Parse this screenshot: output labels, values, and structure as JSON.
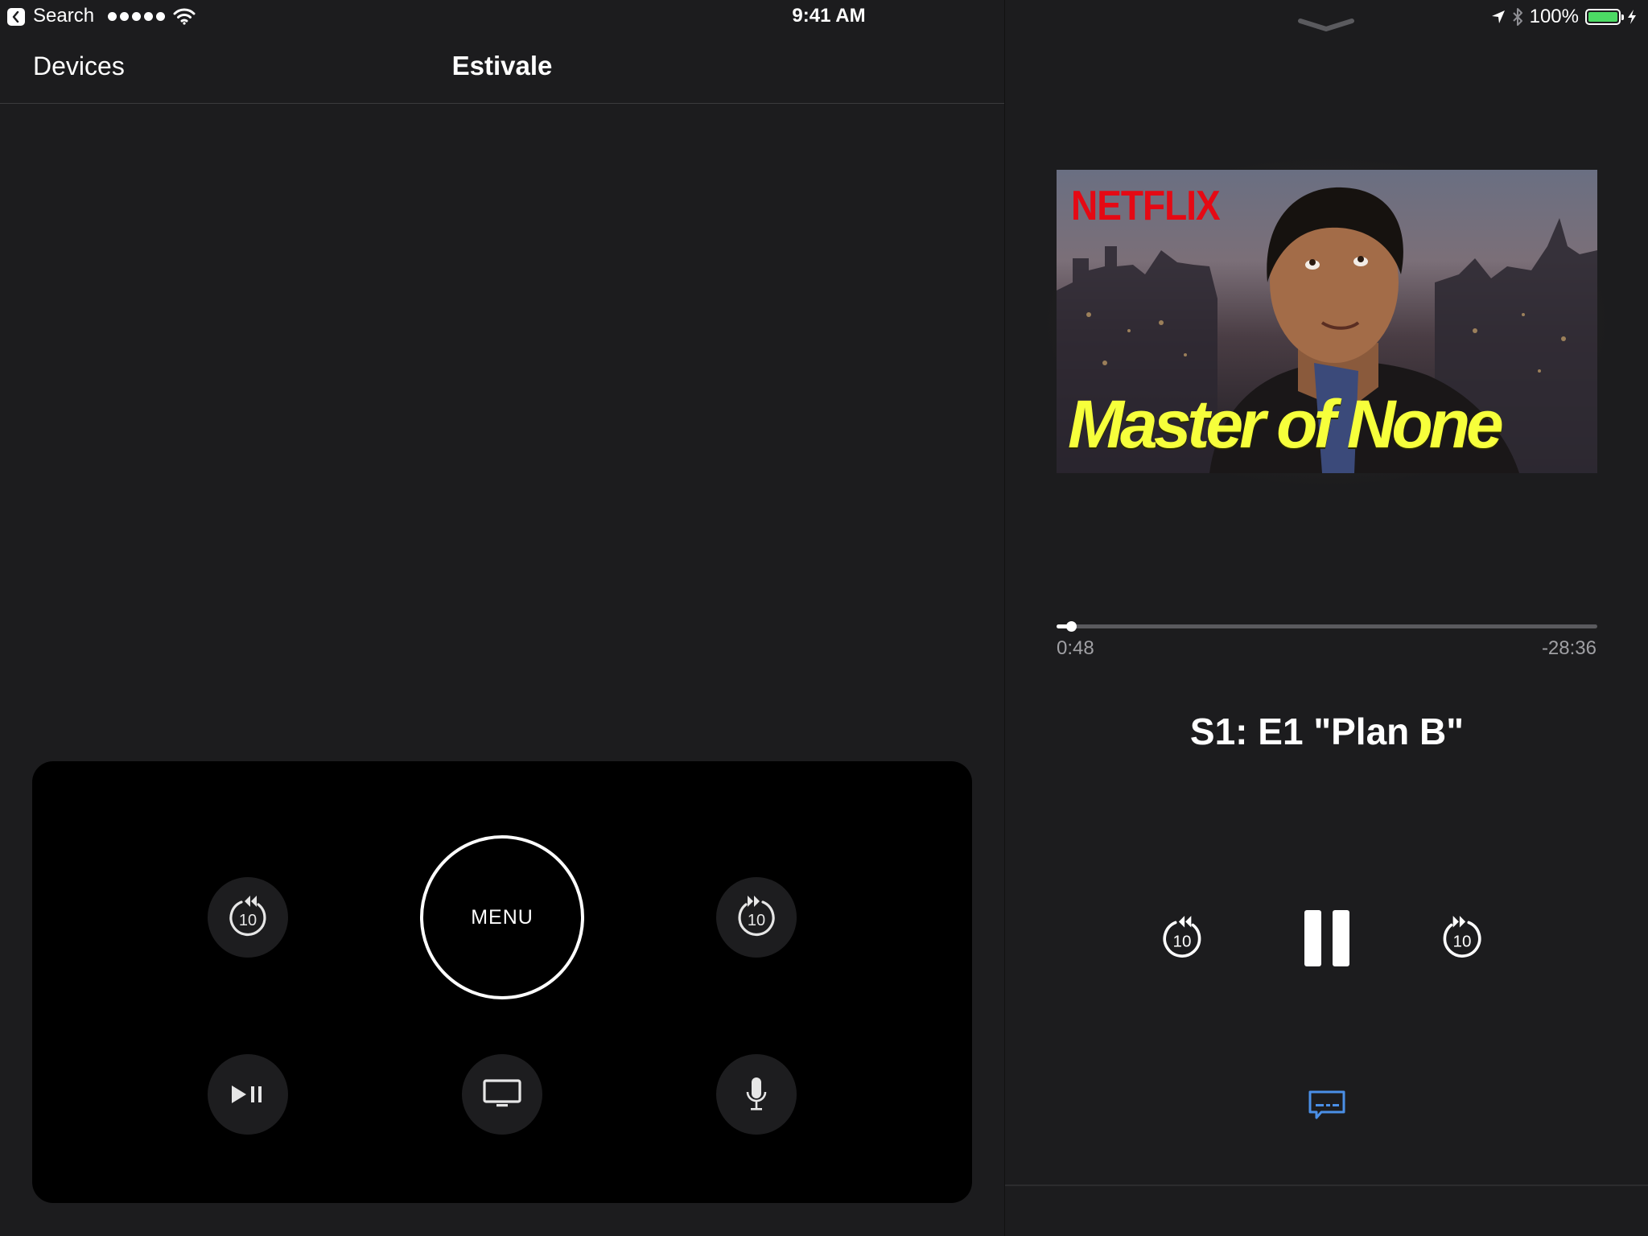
{
  "status_bar": {
    "back_app": "Search",
    "time": "9:41 AM",
    "battery_percent": "100%",
    "signal_bars": 5,
    "battery_color": "#4cd964"
  },
  "navbar": {
    "back_label": "Devices",
    "title": "Estivale"
  },
  "remote": {
    "menu_label": "MENU",
    "skip_back_seconds": "10",
    "skip_forward_seconds": "10",
    "buttons": [
      "skip-back-icon",
      "menu",
      "skip-forward-icon",
      "play-pause-icon",
      "tv-icon",
      "microphone-icon"
    ]
  },
  "now_playing": {
    "artwork": {
      "brand": "NETFLIX",
      "show_title": "Master of None",
      "brand_color": "#e50914",
      "title_color": "#f6ff3b"
    },
    "elapsed": "0:48",
    "remaining": "-28:36",
    "progress_fraction": 0.027,
    "episode_title": "S1: E1 \"Plan B\"",
    "skip_back_seconds": "10",
    "skip_forward_seconds": "10",
    "subtitles_color": "#4a8fe7"
  }
}
